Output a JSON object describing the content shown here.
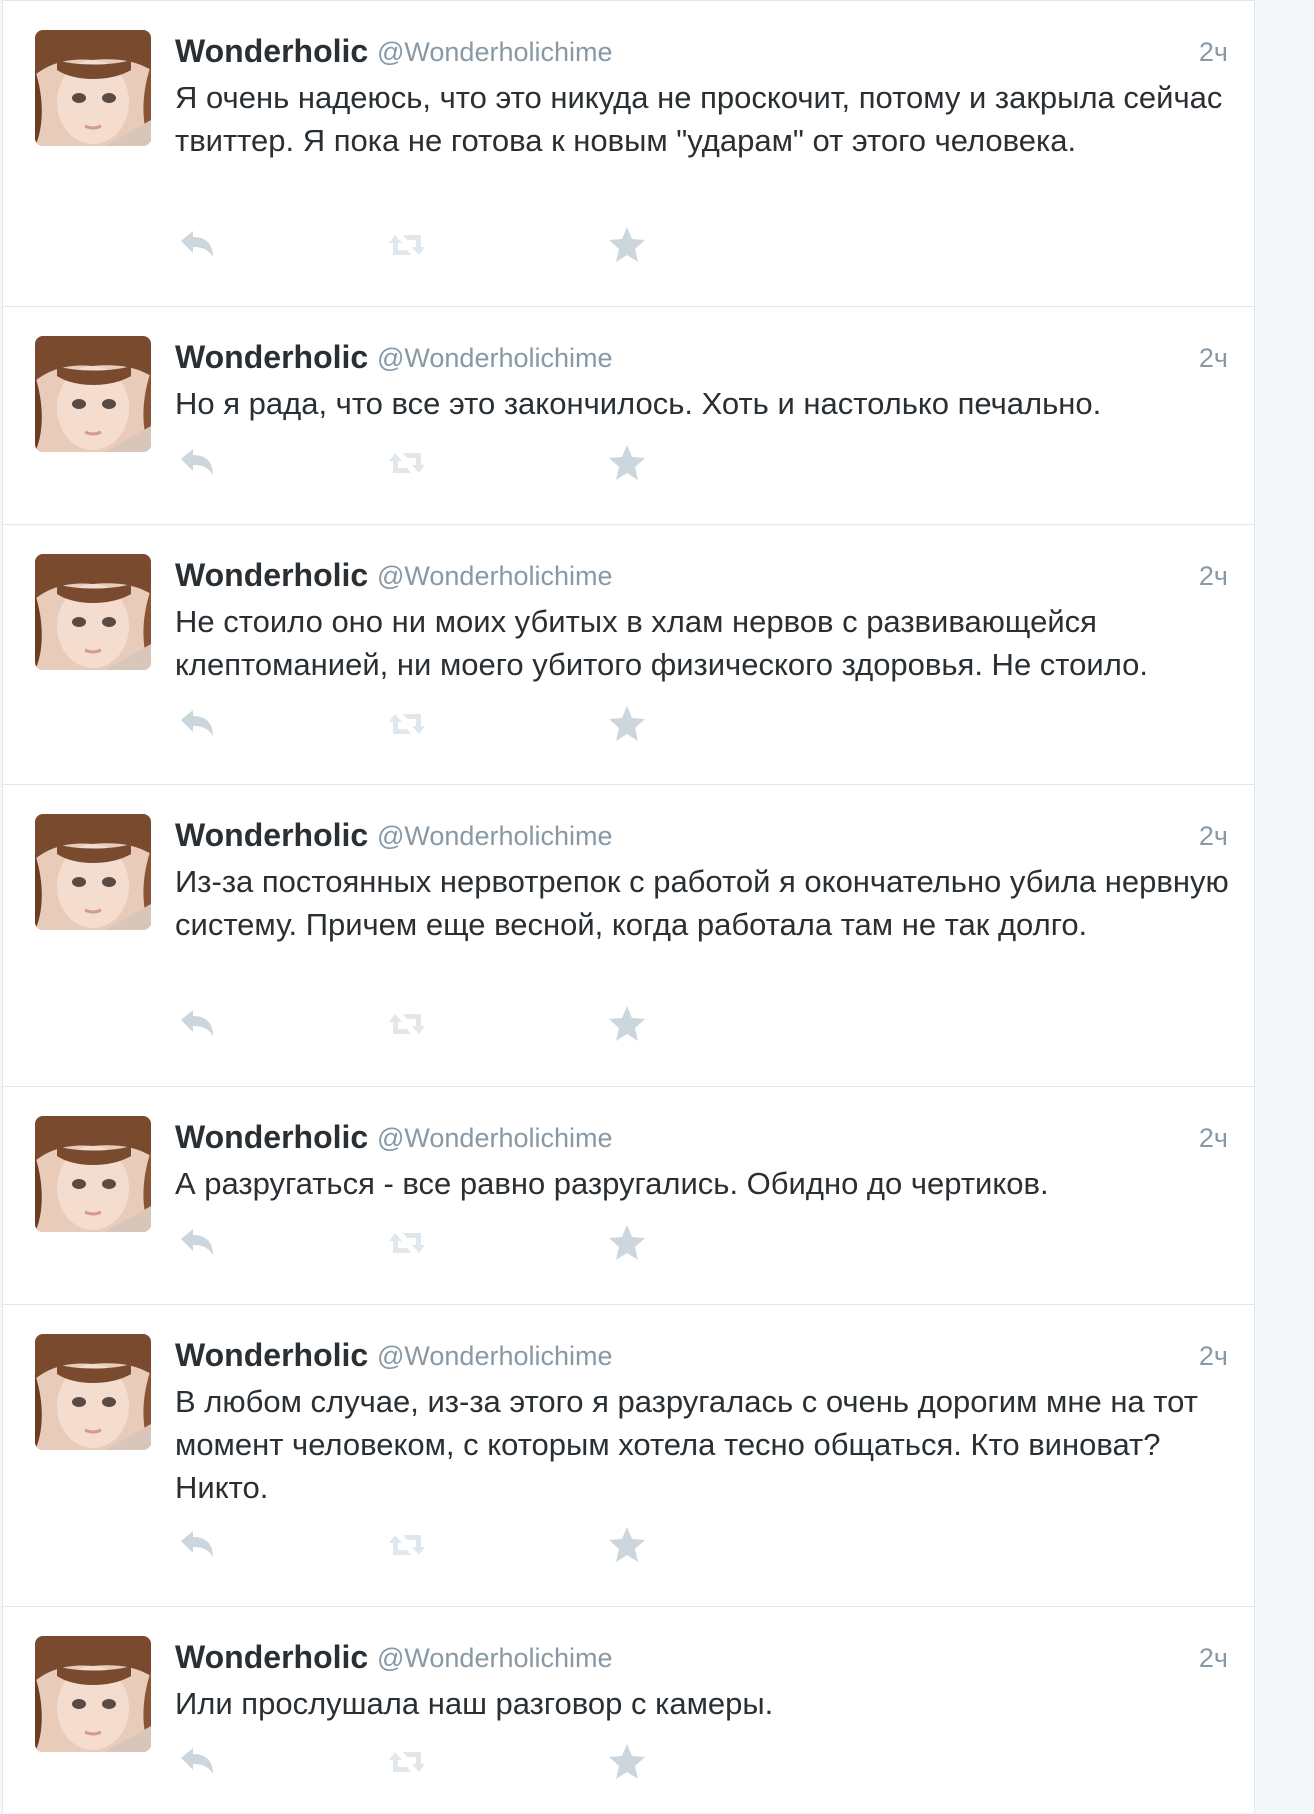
{
  "tweets": [
    {
      "fullname": "Wonderholic",
      "username": "@Wonderholichime",
      "time": "2ч",
      "text": "Я очень надеюсь, что это никуда не проскочит, потому и закрыла сейчас твиттер. Я пока не готова к новым \"ударам\" от этого человека."
    },
    {
      "fullname": "Wonderholic",
      "username": "@Wonderholichime",
      "time": "2ч",
      "text": "Но я рада, что все это закончилось. Хоть и настолько печально."
    },
    {
      "fullname": "Wonderholic",
      "username": "@Wonderholichime",
      "time": "2ч",
      "text": "Не стоило оно ни моих убитых в хлам нервов с развивающейся клептоманией, ни моего убитого физического здоровья. Не стоило."
    },
    {
      "fullname": "Wonderholic",
      "username": "@Wonderholichime",
      "time": "2ч",
      "text": "Из-за постоянных нервотрепок с работой я окончательно убила нервную систему. Причем еще весной, когда работала там не так долго."
    },
    {
      "fullname": "Wonderholic",
      "username": "@Wonderholichime",
      "time": "2ч",
      "text": "А разругаться - все равно разругались. Обидно до чертиков."
    },
    {
      "fullname": "Wonderholic",
      "username": "@Wonderholichime",
      "time": "2ч",
      "text": "В любом случае, из-за этого я разругалась с очень дорогим мне на тот момент человеком, с которым хотела тесно общаться. Кто виноват? Никто."
    },
    {
      "fullname": "Wonderholic",
      "username": "@Wonderholichime",
      "time": "2ч",
      "text": "Или прослушала наш разговор с камеры."
    }
  ],
  "icons": {
    "reply": "reply-icon",
    "retweet": "retweet-icon",
    "favorite": "star-icon"
  },
  "colors": {
    "name": "#292f33",
    "meta": "#8899a6",
    "action_icon": "#ccd6dd",
    "retweet_icon": "#e1e8ed",
    "divider": "#e1e8ed"
  }
}
